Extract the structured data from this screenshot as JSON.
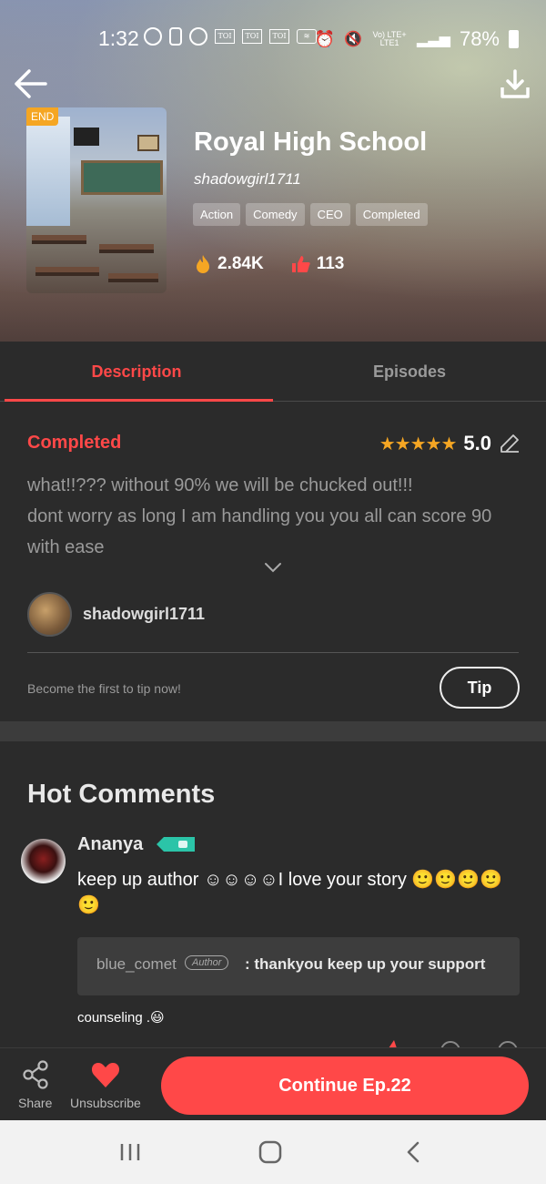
{
  "status_bar": {
    "time": "1:32",
    "battery": "78%",
    "network": "Vo) LTE+ LTE1"
  },
  "book": {
    "title": "Royal High School",
    "author": "shadowgirl1711",
    "badge": "END",
    "tags": [
      "Action",
      "Comedy",
      "CEO",
      "Completed"
    ],
    "views": "2.84K",
    "likes": "113"
  },
  "tabs": [
    {
      "label": "Description",
      "active": true
    },
    {
      "label": "Episodes",
      "active": false
    }
  ],
  "description": {
    "status": "Completed",
    "rating": "5.0",
    "stars": "★★★★★",
    "text_lines": [
      "what!!???  without 90% we will be chucked out!!!",
      "dont worry as long I am handling you you all can score 90",
      "with ease"
    ],
    "author_name": "shadowgirl1711",
    "tip_prompt": "Become the first to tip now!",
    "tip_label": "Tip"
  },
  "comments": {
    "heading": "Hot Comments",
    "items": [
      {
        "user": "Ananya",
        "text": "keep up author ☺☺☺☺I love your story 🙂🙂🙂🙂🙂",
        "reply": {
          "user": "blue_comet",
          "role": "Author",
          "text": ": thankyou keep up your support"
        },
        "footer": "counseling .😃"
      }
    ]
  },
  "actions": {
    "share": "Share",
    "unsubscribe": "Unsubscribe",
    "continue": "Continue Ep.22"
  },
  "colors": {
    "accent": "#ff4848",
    "star": "#f5a623",
    "background": "#2b2b2b"
  }
}
